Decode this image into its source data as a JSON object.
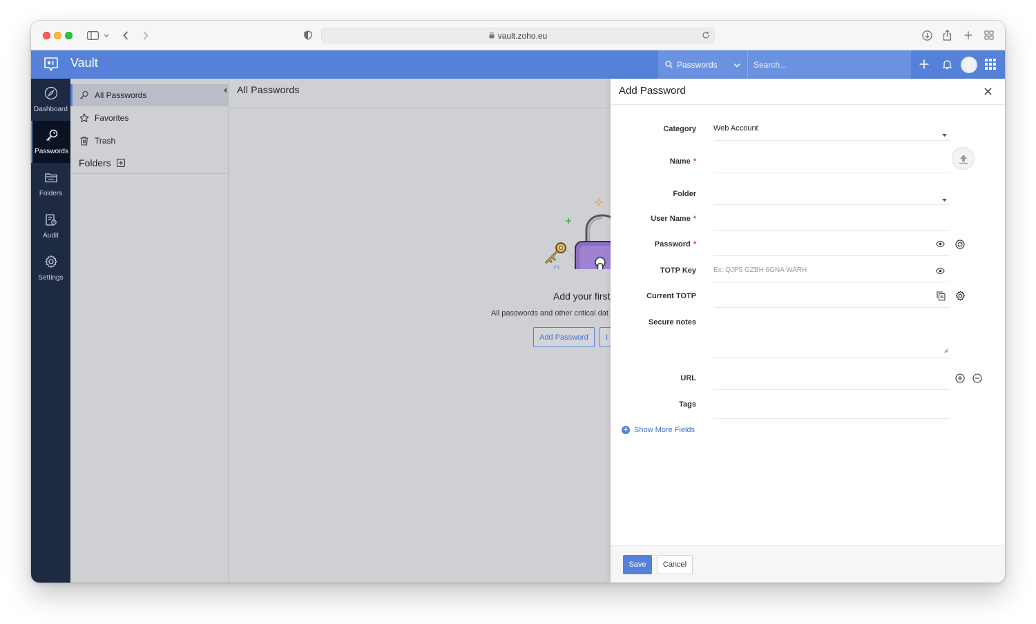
{
  "browser": {
    "url": "vault.zoho.eu"
  },
  "app": {
    "title": "Vault",
    "search_scope": "Passwords",
    "search_placeholder": "Search...",
    "accent_color": "#5581d9"
  },
  "rail": {
    "items": [
      {
        "label": "Dashboard",
        "icon": "compass-icon"
      },
      {
        "label": "Passwords",
        "icon": "key-icon"
      },
      {
        "label": "Folders",
        "icon": "folder-icon"
      },
      {
        "label": "Audit",
        "icon": "audit-icon"
      },
      {
        "label": "Settings",
        "icon": "gear-icon"
      }
    ]
  },
  "sidebar": {
    "items": [
      {
        "label": "All Passwords",
        "icon": "key-icon"
      },
      {
        "label": "Favorites",
        "icon": "star-icon"
      },
      {
        "label": "Trash",
        "icon": "trash-icon"
      }
    ],
    "folders_label": "Folders"
  },
  "main": {
    "title": "All Passwords",
    "empty_title": "Add your first",
    "empty_desc": "All passwords and other critical dat",
    "add_button": "Add Password",
    "import_button_partial": "I"
  },
  "panel": {
    "title": "Add Password",
    "fields": {
      "category": {
        "label": "Category",
        "value": "Web Account"
      },
      "name": {
        "label": "Name",
        "required_mark": "*"
      },
      "folder": {
        "label": "Folder"
      },
      "username": {
        "label": "User Name",
        "required_mark": "*"
      },
      "password": {
        "label": "Password",
        "required_mark": "*"
      },
      "totp_key": {
        "label": "TOTP Key",
        "placeholder": "Ex: QJP5 GZBH 6GNA WARH"
      },
      "current_totp": {
        "label": "Current TOTP"
      },
      "secure_notes": {
        "label": "Secure notes"
      },
      "url": {
        "label": "URL"
      },
      "tags": {
        "label": "Tags"
      }
    },
    "show_more": "Show More Fields",
    "save": "Save",
    "cancel": "Cancel"
  }
}
